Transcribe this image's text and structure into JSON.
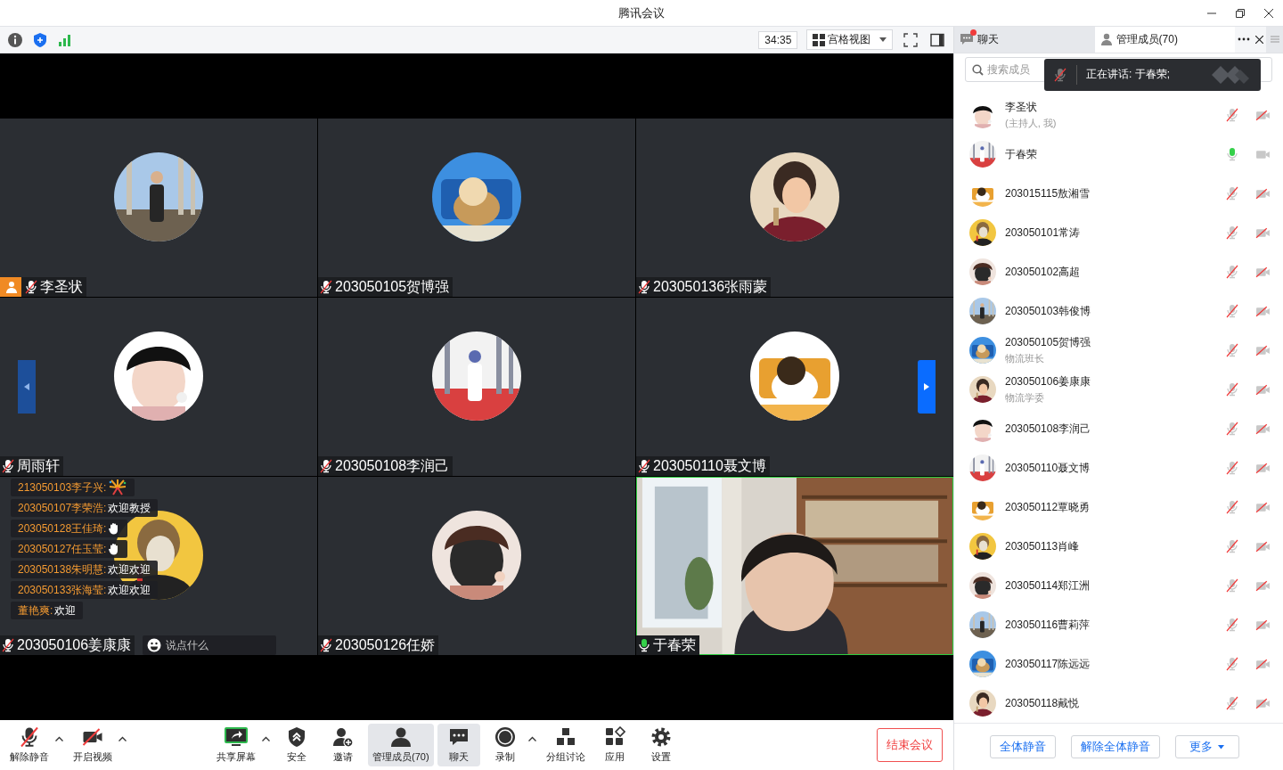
{
  "window": {
    "title": "腾讯会议"
  },
  "top_bar": {
    "timer": "34:35",
    "view_mode": "宫格视图"
  },
  "side_tabs": [
    {
      "label": "聊天",
      "selected": false,
      "unread": true
    },
    {
      "label": "管理成员(70)",
      "selected": true,
      "unread": false
    }
  ],
  "video_tiles": [
    {
      "name": "李圣状",
      "kind": "avatar",
      "host": true,
      "mic_on": false,
      "speaking": false
    },
    {
      "name": "203050105贺博强",
      "kind": "avatar",
      "host": false,
      "mic_on": false,
      "speaking": false
    },
    {
      "name": "203050136张雨蒙",
      "kind": "avatar",
      "host": false,
      "mic_on": false,
      "speaking": false
    },
    {
      "name": "周雨轩",
      "kind": "avatar",
      "host": false,
      "mic_on": false,
      "speaking": false
    },
    {
      "name": "203050108李润己",
      "kind": "avatar",
      "host": false,
      "mic_on": false,
      "speaking": false
    },
    {
      "name": "203050110聂文博",
      "kind": "avatar",
      "host": false,
      "mic_on": false,
      "speaking": false
    },
    {
      "name": "203050106姜康康",
      "kind": "avatar",
      "host": false,
      "mic_on": false,
      "speaking": false
    },
    {
      "name": "203050126任娇",
      "kind": "avatar",
      "host": false,
      "mic_on": false,
      "speaking": false
    },
    {
      "name": "于春荣",
      "kind": "video",
      "host": false,
      "mic_on": true,
      "speaking": true
    }
  ],
  "chat_overlay": {
    "messages": [
      {
        "sender": "213050103李子兴:",
        "kind": "firework"
      },
      {
        "sender": "203050107李荣浩:",
        "kind": "text",
        "text": "欢迎教授"
      },
      {
        "sender": "203050128王佳琦:",
        "kind": "wave"
      },
      {
        "sender": "203050127任玉莹:",
        "kind": "wave"
      },
      {
        "sender": "203050138朱明慧:",
        "kind": "text",
        "text": "欢迎欢迎"
      },
      {
        "sender": "203050133张海莹:",
        "kind": "text",
        "text": "欢迎欢迎"
      },
      {
        "sender": "董艳爽:",
        "kind": "text",
        "text": "欢迎"
      }
    ],
    "placeholder": "说点什么"
  },
  "members_panel": {
    "search": {
      "placeholder": "搜索成员"
    },
    "speaking_toast": "正在讲话: 于春荣;",
    "members": [
      {
        "name": "李圣状",
        "role": "(主持人, 我)",
        "mic_on": false,
        "cam_on": false
      },
      {
        "name": "于春荣",
        "mic_on": true,
        "cam_on": true
      },
      {
        "name": "203015115敖湘雪",
        "mic_on": false,
        "cam_on": false
      },
      {
        "name": "203050101常涛",
        "mic_on": false,
        "cam_on": false
      },
      {
        "name": "203050102高超",
        "mic_on": false,
        "cam_on": false
      },
      {
        "name": "203050103韩俊博",
        "mic_on": false,
        "cam_on": false
      },
      {
        "name": "203050105贺博强",
        "role": "物流班长",
        "mic_on": false,
        "cam_on": false
      },
      {
        "name": "203050106姜康康",
        "role": "物流学委",
        "mic_on": false,
        "cam_on": false
      },
      {
        "name": "203050108李润己",
        "mic_on": false,
        "cam_on": false
      },
      {
        "name": "203050110聂文博",
        "mic_on": false,
        "cam_on": false
      },
      {
        "name": "203050112覃晓勇",
        "mic_on": false,
        "cam_on": false
      },
      {
        "name": "203050113肖峰",
        "mic_on": false,
        "cam_on": false
      },
      {
        "name": "203050114郑江洲",
        "mic_on": false,
        "cam_on": false
      },
      {
        "name": "203050116曹莉萍",
        "mic_on": false,
        "cam_on": false
      },
      {
        "name": "203050117陈远远",
        "mic_on": false,
        "cam_on": false
      },
      {
        "name": "203050118戴悦",
        "mic_on": false,
        "cam_on": false
      }
    ],
    "buttons": [
      {
        "label": "全体静音",
        "kind": "plain"
      },
      {
        "label": "解除全体静音",
        "kind": "plain"
      },
      {
        "label": "更多",
        "kind": "menu"
      }
    ]
  },
  "toolbar": {
    "items": [
      {
        "label": "解除静音",
        "kind": "mic",
        "off": true,
        "caret": true,
        "selected": false
      },
      {
        "label": "开启视频",
        "kind": "camera",
        "off": true,
        "caret": true,
        "selected": false
      },
      {
        "label": "共享屏幕",
        "kind": "share",
        "caret": true,
        "selected": false
      },
      {
        "label": "安全",
        "kind": "security",
        "caret": false,
        "selected": false
      },
      {
        "label": "邀请",
        "kind": "invite",
        "caret": false,
        "selected": false
      },
      {
        "label": "管理成员(70)",
        "kind": "members",
        "caret": false,
        "selected": true
      },
      {
        "label": "聊天",
        "kind": "chat",
        "caret": false,
        "selected": true
      },
      {
        "label": "录制",
        "kind": "record",
        "caret": true,
        "selected": false
      },
      {
        "label": "分组讨论",
        "kind": "breakout",
        "caret": false,
        "selected": false
      },
      {
        "label": "应用",
        "kind": "apps",
        "caret": false,
        "selected": false
      },
      {
        "label": "设置",
        "kind": "settings",
        "caret": false,
        "selected": false
      }
    ],
    "end_button": "结束会议"
  }
}
